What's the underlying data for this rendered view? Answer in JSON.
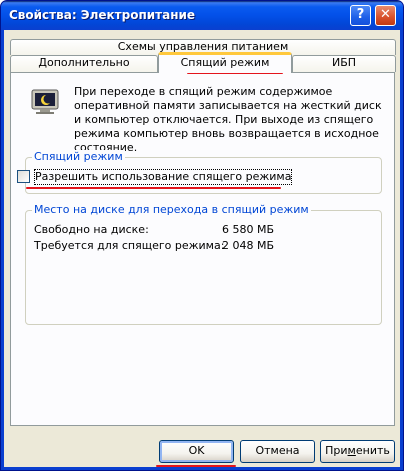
{
  "window": {
    "title": "Свойства: Электропитание",
    "help_label": "?",
    "close_label": "✕"
  },
  "tabs": {
    "row1": [
      "Схемы управления питанием"
    ],
    "row2": [
      "Дополнительно",
      "Спящий режим",
      "ИБП"
    ],
    "active": "Спящий режим"
  },
  "hibernate": {
    "description": "При переходе в спящий режим содержимое оперативной памяти записывается на жесткий диск и компьютер отключается. При выходе из спящего режима компьютер вновь возвращается в исходное состояние.",
    "group_label": "Спящий режим",
    "enable_checkbox": {
      "label": "Разрешить использование спящего режима",
      "checked": false
    },
    "disk_group_label": "Место на диске для перехода в спящий режим",
    "free_label": "Свободно на диске:",
    "free_value": "6 580 МБ",
    "required_label": "Требуется для спящего режима:",
    "required_value": "2 048 МБ"
  },
  "buttons": {
    "ok": "OK",
    "cancel": "Отмена",
    "apply_prefix": "При",
    "apply_underlined": "м",
    "apply_suffix": "енить"
  },
  "colors": {
    "titlebar": "#0a5bf0",
    "dialog_bg": "#ece9d8",
    "group_label": "#0046d5",
    "annotation_marks": "#e4141c"
  }
}
